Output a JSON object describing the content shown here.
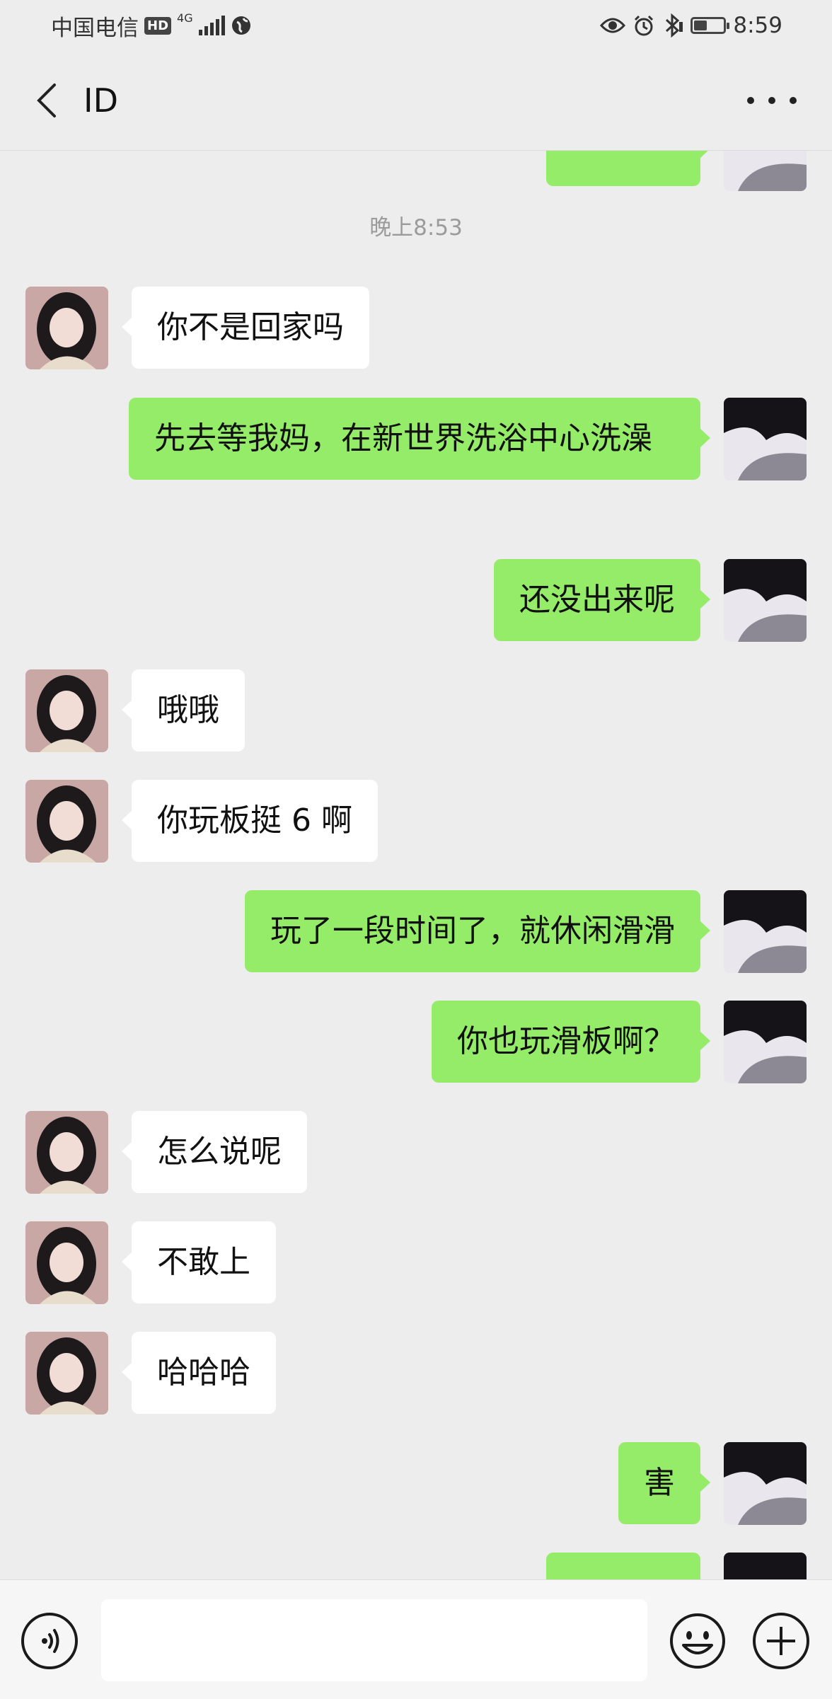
{
  "status_bar": {
    "carrier": "中国电信",
    "hd_badge": "HD",
    "network": "4G",
    "time": "8:59",
    "icons": [
      "hd-icon",
      "signal-icon",
      "wifi-globe-icon",
      "eye-icon",
      "alarm-icon",
      "bluetooth-icon",
      "battery-icon"
    ],
    "battery_level": 0.45
  },
  "header": {
    "title": "ID",
    "back_icon": "back-chevron-icon",
    "more_icon": "more-dots-icon"
  },
  "chat": {
    "partial_top_message": {
      "side": "right",
      "text": ""
    },
    "timestamp": "晚上8:53",
    "messages": [
      {
        "side": "left",
        "text": "你不是回家吗"
      },
      {
        "side": "right",
        "text": "先去等我妈，在新世界洗浴中心洗澡"
      },
      {
        "side": "right",
        "text": "还没出来呢"
      },
      {
        "side": "left",
        "text": "哦哦"
      },
      {
        "side": "left",
        "text": "你玩板挺 6 啊"
      },
      {
        "side": "right",
        "text": "玩了一段时间了，就休闲滑滑"
      },
      {
        "side": "right",
        "text": "你也玩滑板啊？"
      },
      {
        "side": "left",
        "text": "怎么说呢"
      },
      {
        "side": "left",
        "text": "不敢上"
      },
      {
        "side": "left",
        "text": "哈哈哈"
      },
      {
        "side": "right",
        "text": "害"
      }
    ],
    "partial_bottom_message": {
      "side": "right",
      "text": ""
    }
  },
  "input_bar": {
    "voice_icon": "voice-icon",
    "input_value": "",
    "emoji_icon": "emoji-icon",
    "plus_icon": "plus-icon"
  },
  "colors": {
    "background": "#ededed",
    "bubble_self": "#95ec69",
    "bubble_other": "#ffffff",
    "timestamp": "#9b9b9b"
  }
}
